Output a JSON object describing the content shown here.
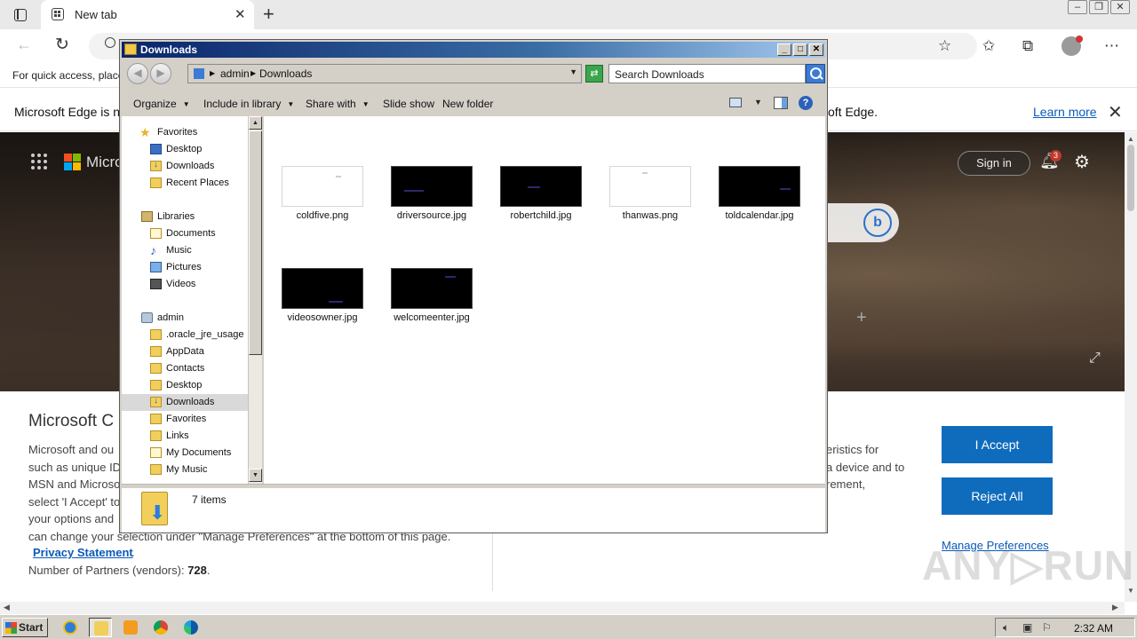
{
  "browser": {
    "tab_title": "New tab",
    "tab_close": "✕",
    "new_tab": "+",
    "favorites_hint": "For quick access, place",
    "info_bar": {
      "left_text": "Microsoft Edge is no",
      "right_text": "oft Edge.",
      "learn_more": "Learn more",
      "close": "✕"
    },
    "hero": {
      "ms_text": "Micro",
      "sign_in": "Sign in",
      "notification_count": "3",
      "bing_letter": "b",
      "plus": "+"
    }
  },
  "consent": {
    "title": "Microsoft C",
    "paragraph": "Microsoft and ou such as unique ID MSN and Microso select 'I Accept' to your options and can change your selection under \"Manage Preferences\" at the bottom of this page.",
    "para_lines": [
      "Microsoft and ou",
      "such as unique ID",
      "MSN and Microso",
      "select 'I Accept' to",
      "your options and",
      "can change your selection under \"Manage Preferences\" at the bottom of this page."
    ],
    "privacy_link": "Privacy Statement",
    "privacy_suffix": ".",
    "partners_label": "Number of Partners (vendors): ",
    "partners_count": "728",
    "partners_suffix": ".",
    "right_lines": [
      "eristics for",
      "a device and to",
      "rement,"
    ],
    "accept": "I Accept",
    "reject": "Reject All",
    "manage": "Manage Preferences"
  },
  "watermark": "ANY▷RUN",
  "explorer": {
    "title": "Downloads",
    "breadcrumb": [
      "admin",
      "Downloads"
    ],
    "search_placeholder": "Search Downloads",
    "commands": {
      "organize": "Organize",
      "include_in_library": "Include in library",
      "share_with": "Share with",
      "slide_show": "Slide show",
      "new_folder": "New folder"
    },
    "nav": {
      "favorites": "Favorites",
      "desktop": "Desktop",
      "downloads": "Downloads",
      "recent_places": "Recent Places",
      "libraries": "Libraries",
      "documents": "Documents",
      "music": "Music",
      "pictures": "Pictures",
      "videos": "Videos",
      "admin": "admin",
      "oracle": ".oracle_jre_usage",
      "appdata": "AppData",
      "contacts": "Contacts",
      "desktop2": "Desktop",
      "downloads2": "Downloads",
      "favorites2": "Favorites",
      "links": "Links",
      "my_documents": "My Documents",
      "my_music": "My Music"
    },
    "files": [
      {
        "name": "coldfive.png",
        "thumb": "light"
      },
      {
        "name": "driversource.jpg",
        "thumb": "dark"
      },
      {
        "name": "robertchild.jpg",
        "thumb": "dark"
      },
      {
        "name": "thanwas.png",
        "thumb": "light"
      },
      {
        "name": "toldcalendar.jpg",
        "thumb": "dark"
      },
      {
        "name": "videosowner.jpg",
        "thumb": "dark"
      },
      {
        "name": "welcomeenter.jpg",
        "thumb": "dark"
      }
    ],
    "item_count": "7 items"
  },
  "taskbar": {
    "start": "Start",
    "clock": "2:32 AM"
  },
  "colors": {
    "accent_blue": "#0f6cbd",
    "link_blue": "#0a5bb8",
    "titlebar_start": "#0a246a",
    "taskbar": "#d4d0c8"
  }
}
